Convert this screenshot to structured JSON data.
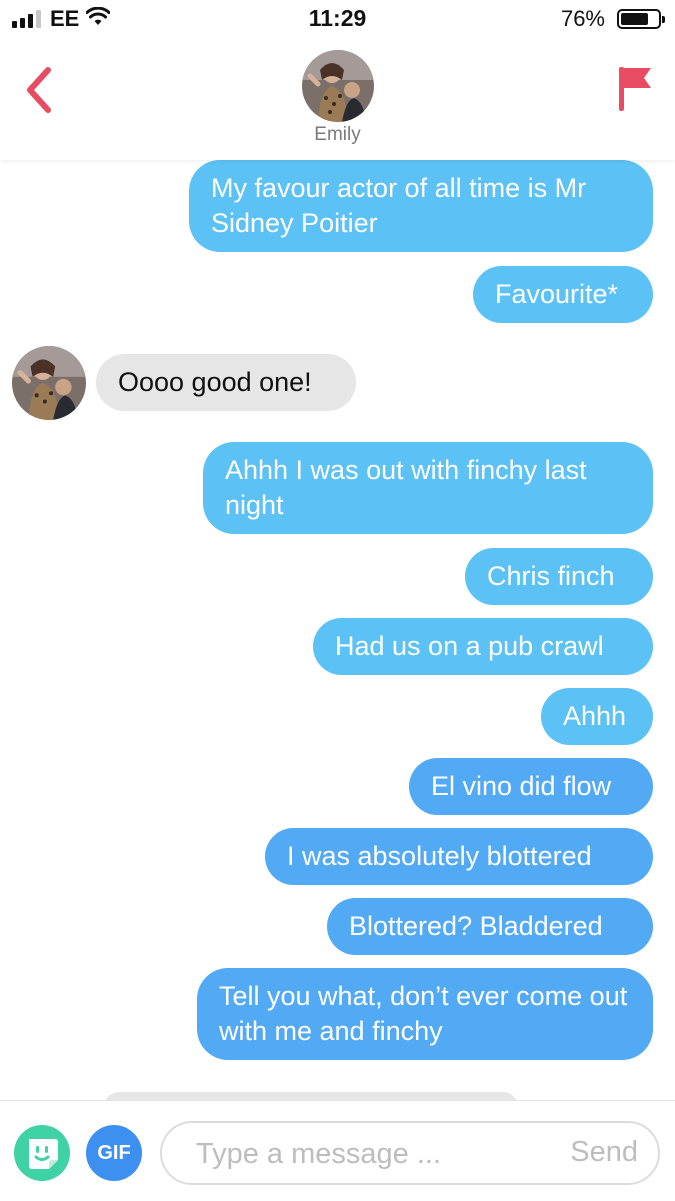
{
  "status_bar": {
    "carrier": "EE",
    "time": "11:29",
    "battery_percent": "76%",
    "battery_level": 0.76,
    "signal_bars": 3,
    "icons": [
      "signal-icon",
      "wifi-icon",
      "battery-icon"
    ]
  },
  "header": {
    "contact_name": "Emily",
    "icons": [
      "back-chevron-icon",
      "report-flag-icon",
      "contact-avatar"
    ],
    "accent_color": "#e84c62"
  },
  "messages": [
    {
      "direction": "sent",
      "text": "My favour actor of all time is Mr Sidney Poitier"
    },
    {
      "direction": "sent",
      "text": "Favourite*"
    },
    {
      "direction": "received",
      "text": "Oooo good one!"
    },
    {
      "direction": "sent",
      "text": "Ahhh I was out with finchy last night"
    },
    {
      "direction": "sent",
      "text": "Chris finch"
    },
    {
      "direction": "sent",
      "text": "Had us on a pub crawl"
    },
    {
      "direction": "sent",
      "text": "Ahhh"
    },
    {
      "direction": "sent",
      "text": "El vino did flow"
    },
    {
      "direction": "sent",
      "text": "I was absolutely blottered"
    },
    {
      "direction": "sent",
      "text": "Blottered? Bladdered"
    },
    {
      "direction": "sent",
      "text": "Tell you what, don’t ever come out with me and finchy"
    }
  ],
  "composer": {
    "sticker_icon": "sticker-icon",
    "gif_label": "GIF",
    "input_placeholder": "Type a message ...",
    "input_value": "",
    "send_label": "Send"
  },
  "colors": {
    "sent_bubble": "#5cc1f5",
    "sent_bubble_deep": "#52a9f4",
    "received_bubble": "#e6e6e6",
    "sticker_button": "#3fd2a4",
    "gif_button": "#3d8ff0"
  }
}
